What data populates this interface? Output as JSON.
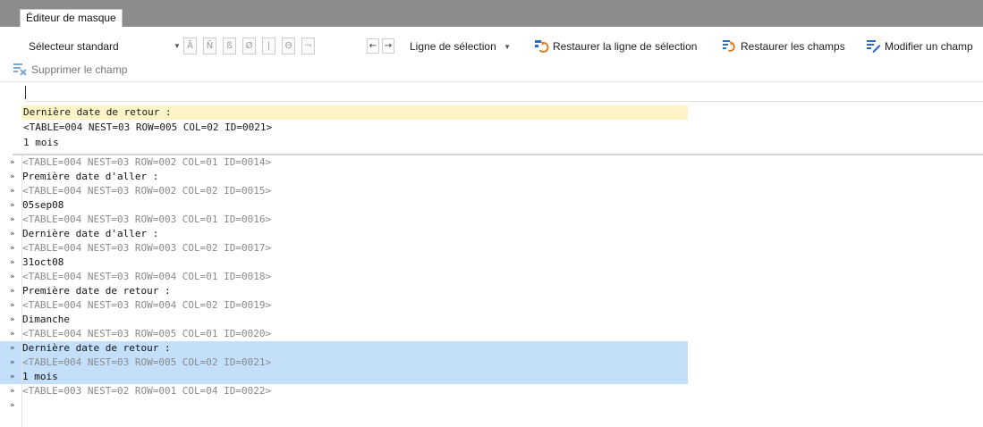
{
  "tab": {
    "label": "Éditeur de masque"
  },
  "toolbar": {
    "selector": "Sélecteur standard",
    "glyphs": [
      "Ã",
      "Ñ",
      "ß",
      "Ø",
      "|",
      "Θ",
      "¬"
    ],
    "nav_prev": "←",
    "nav_next": "→",
    "selection_line": "Ligne de sélection",
    "restore_selection_line": "Restaurer la ligne de sélection",
    "restore_fields": "Restaurer les champs",
    "modify_field": "Modifier un champ",
    "delete_field": "Supprimer le champ",
    "colors": {
      "icon_blue": "#2b6cc4",
      "icon_orange": "#e07b20"
    }
  },
  "preview": {
    "lines": [
      "Dernière date de retour :",
      "<TABLE=004 NEST=03 ROW=005 COL=02 ID=0021>",
      "1 mois"
    ],
    "highlight_color": "#fcf4c6"
  },
  "list": {
    "marker": "»",
    "selection_color": "#c3dffa",
    "rows": [
      {
        "text": "<TABLE=004 NEST=03 ROW=002 COL=01 ID=0014>",
        "kind": "tag"
      },
      {
        "text": "Première date d'aller :",
        "kind": "val"
      },
      {
        "text": "<TABLE=004 NEST=03 ROW=002 COL=02 ID=0015>",
        "kind": "tag"
      },
      {
        "text": "05sep08",
        "kind": "val"
      },
      {
        "text": "<TABLE=004 NEST=03 ROW=003 COL=01 ID=0016>",
        "kind": "tag"
      },
      {
        "text": "Dernière date d'aller :",
        "kind": "val"
      },
      {
        "text": "<TABLE=004 NEST=03 ROW=003 COL=02 ID=0017>",
        "kind": "tag"
      },
      {
        "text": "31oct08",
        "kind": "val"
      },
      {
        "text": "<TABLE=004 NEST=03 ROW=004 COL=01 ID=0018>",
        "kind": "tag"
      },
      {
        "text": "Première date de retour :",
        "kind": "val"
      },
      {
        "text": "<TABLE=004 NEST=03 ROW=004 COL=02 ID=0019>",
        "kind": "tag"
      },
      {
        "text": "Dimanche",
        "kind": "val"
      },
      {
        "text": "<TABLE=004 NEST=03 ROW=005 COL=01 ID=0020>",
        "kind": "tag"
      },
      {
        "text": "Dernière date de retour :",
        "kind": "val",
        "selected": true
      },
      {
        "text": "<TABLE=004 NEST=03 ROW=005 COL=02 ID=0021>",
        "kind": "tag",
        "selected": true
      },
      {
        "text": "1 mois",
        "kind": "val",
        "selected": true
      },
      {
        "text": "<TABLE=003 NEST=02 ROW=001 COL=04 ID=0022>",
        "kind": "tag"
      },
      {
        "text": "",
        "kind": "val"
      }
    ]
  }
}
